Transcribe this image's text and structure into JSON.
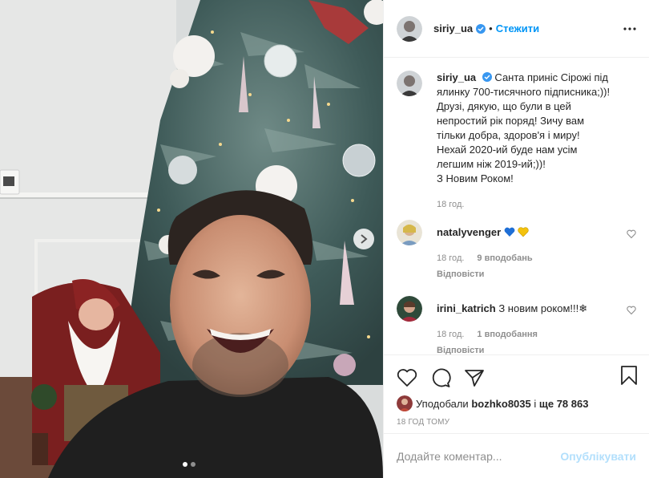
{
  "post": {
    "author": "siriy_ua",
    "follow_sep": "•",
    "follow_label": "Стежити",
    "caption_lines": [
      "Санта приніс Сірожі під",
      "ялинку 700-тисячного підписника;))!",
      "Друзі, дякую, що були в цей",
      "непростий рік поряд! Зичу вам",
      "тільки добра, здоров'я і миру!",
      "Нехай 2020-ий буде нам усім",
      "легшим ніж 2019-ий;))!",
      "З Новим Роком!"
    ],
    "caption_time": "18 год."
  },
  "comments": [
    {
      "user": "natalyvenger",
      "text": "",
      "emoji": [
        "blue-heart",
        "yellow-heart"
      ],
      "time": "18 год.",
      "likes": "9 вподобань",
      "reply": "Відповісти"
    },
    {
      "user": "irini_katrich",
      "text": "З новим роком!!!❄",
      "time": "18 год.",
      "likes": "1 вподобання",
      "reply": "Відповісти"
    }
  ],
  "likes_line": {
    "prefix": "Уподобали",
    "user": "bozhko8035",
    "mid": "і",
    "count": "ще 78 863"
  },
  "time_ago": "18 ГОД ТОМУ",
  "comment_input": {
    "placeholder": "Додайте коментар..."
  },
  "publish_label": "Опублікувати",
  "colors": {
    "accent": "#0095f6",
    "publish_disabled": "#b2dffc",
    "muted": "#8e8e8e",
    "verified": "#3897f0"
  },
  "icons": [
    "more-icon",
    "heart-icon",
    "comment-icon",
    "share-icon",
    "save-icon",
    "verified-icon",
    "next-arrow-icon"
  ]
}
